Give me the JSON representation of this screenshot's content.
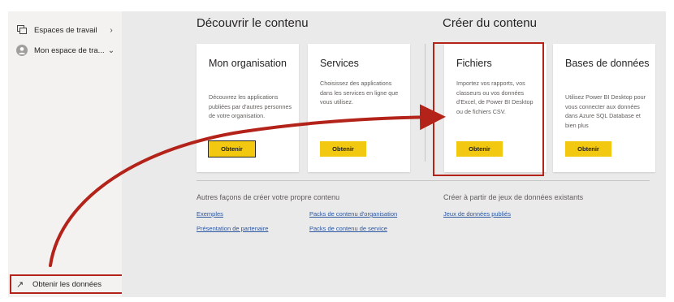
{
  "sidebar": {
    "items": [
      {
        "label": "Espaces de travail",
        "icon": "workspaces-icon",
        "chevron": "›"
      },
      {
        "label": "Mon espace de tra...",
        "icon": "avatar-icon",
        "chevron": "⌄"
      }
    ],
    "get_data": {
      "label": "Obtenir les données",
      "icon": "arrow-up-right-icon"
    }
  },
  "main": {
    "discover_title": "Découvrir le contenu",
    "create_title": "Créer du contenu",
    "cards": [
      {
        "title": "Mon organisation",
        "description": "Découvrez les applications publiées par d'autres personnes de votre organisation.",
        "button": "Obtenir"
      },
      {
        "title": "Services",
        "description": "Choisissez des applications dans les services en ligne que vous utilisez.",
        "button": "Obtenir"
      },
      {
        "title": "Fichiers",
        "description": "Importez vos rapports, vos classeurs ou vos données d'Excel, de Power BI Desktop ou de fichiers CSV.",
        "button": "Obtenir"
      },
      {
        "title": "Bases de données",
        "description": "Utilisez Power BI Desktop pour vous connecter aux données dans Azure SQL Database et bien plus",
        "button": "Obtenir"
      }
    ],
    "other_ways_title": "Autres façons de créer votre propre contenu",
    "other_ways_links": [
      "Exemples",
      "Packs de contenu d'organisation",
      "Présentation de partenaire",
      "Packs de contenu de service"
    ],
    "datasets_title": "Créer à partir de jeux de données existants",
    "datasets_link": "Jeux de données publiés"
  },
  "colors": {
    "accent_button": "#f2c811",
    "highlight": "#b3231a",
    "link": "#2b57a0"
  }
}
